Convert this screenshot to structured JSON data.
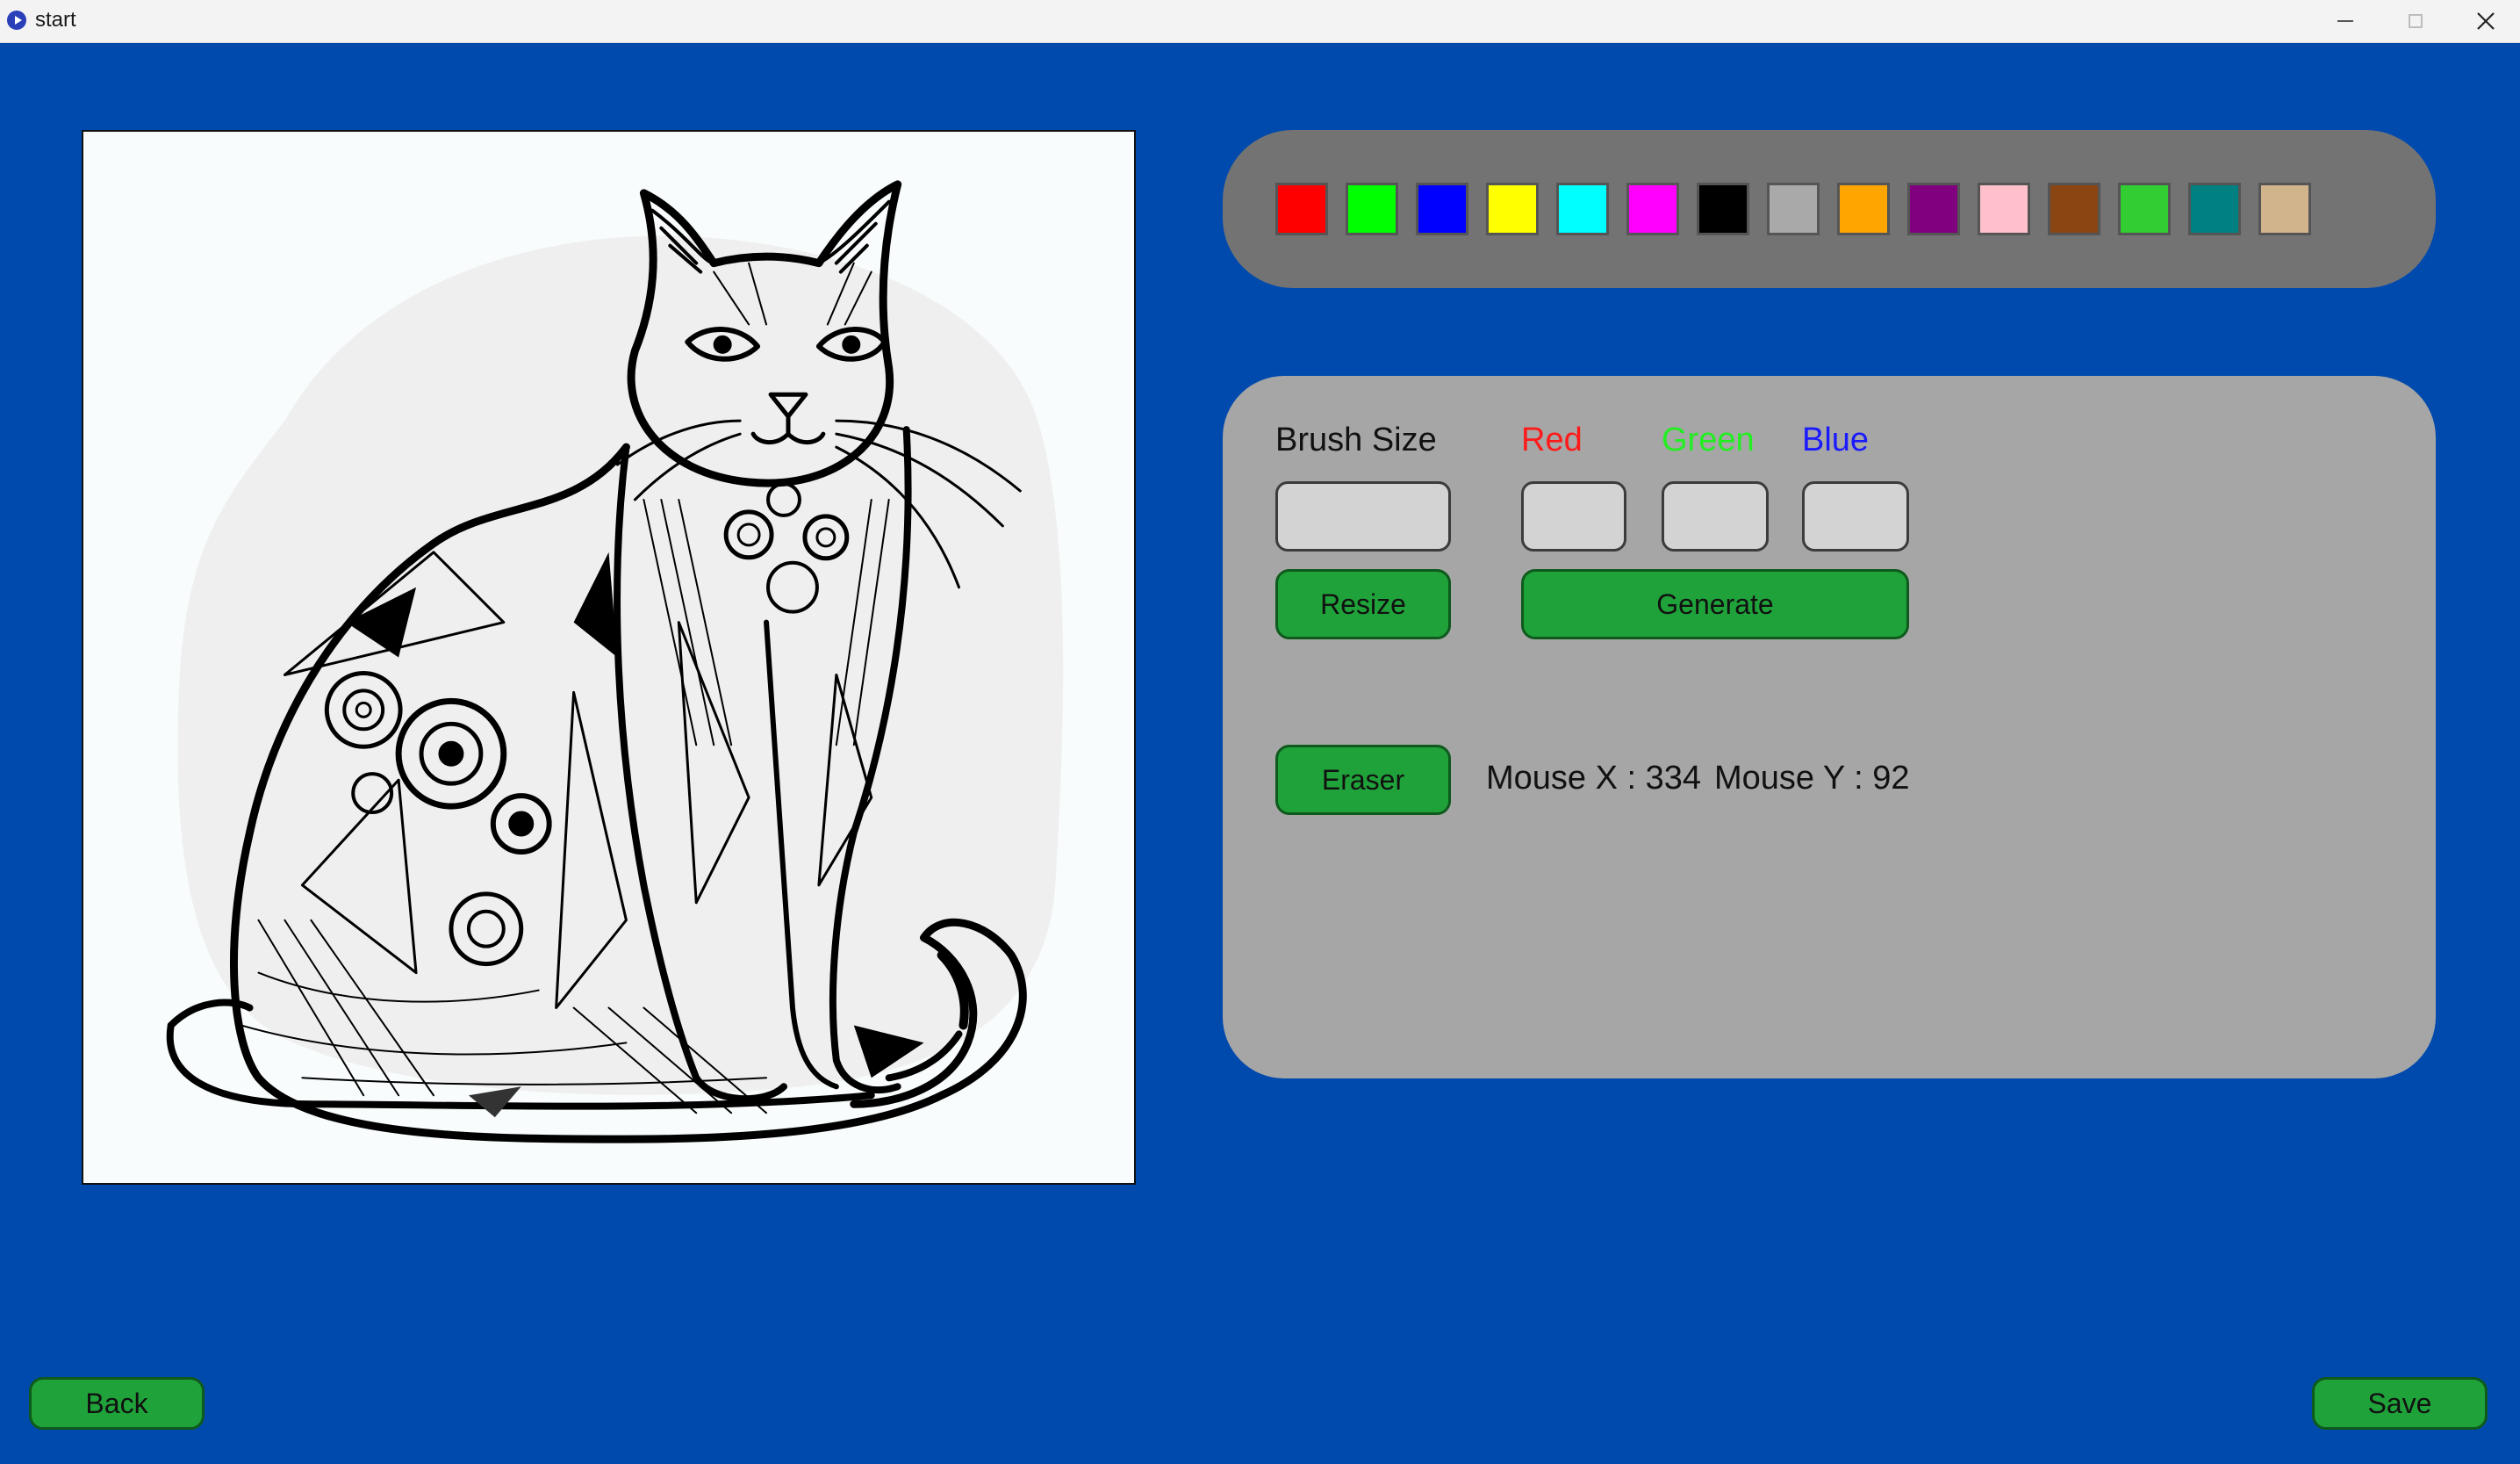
{
  "window": {
    "title": "start",
    "icon": "app-play-icon",
    "controls": [
      "minimize-icon",
      "maximize-icon",
      "close-icon"
    ]
  },
  "canvas": {
    "image": "geometric-line-art-cat"
  },
  "palette": {
    "colors": [
      {
        "name": "red",
        "hex": "#ff0000"
      },
      {
        "name": "lime",
        "hex": "#00ff00"
      },
      {
        "name": "blue",
        "hex": "#0000ff"
      },
      {
        "name": "yellow",
        "hex": "#ffff00"
      },
      {
        "name": "cyan",
        "hex": "#00ffff"
      },
      {
        "name": "magenta",
        "hex": "#ff00ff"
      },
      {
        "name": "black",
        "hex": "#000000"
      },
      {
        "name": "gray",
        "hex": "#a9a9a9"
      },
      {
        "name": "orange",
        "hex": "#ffa500"
      },
      {
        "name": "purple",
        "hex": "#800080"
      },
      {
        "name": "pink",
        "hex": "#ffc0cb"
      },
      {
        "name": "brown",
        "hex": "#8b4513"
      },
      {
        "name": "green",
        "hex": "#32cd32"
      },
      {
        "name": "teal",
        "hex": "#008080"
      },
      {
        "name": "tan",
        "hex": "#d2b48c"
      }
    ]
  },
  "controls": {
    "brush_size_label": "Brush Size",
    "red_label": "Red",
    "green_label": "Green",
    "blue_label": "Blue",
    "brush_size_value": "",
    "red_value": "",
    "green_value": "",
    "blue_value": "",
    "resize_label": "Resize",
    "generate_label": "Generate",
    "eraser_label": "Eraser",
    "mouse_x": "Mouse X : 334",
    "mouse_y": "Mouse Y : 92"
  },
  "colors": {
    "background": "#004aad",
    "palette_panel": "#737373",
    "controls_panel": "#a6a6a6",
    "button_green": "#20a23a",
    "red_label": "#ff1a1a",
    "green_label": "#22ee22",
    "blue_label": "#1a1aff"
  },
  "footer": {
    "back_label": "Back",
    "save_label": "Save"
  }
}
